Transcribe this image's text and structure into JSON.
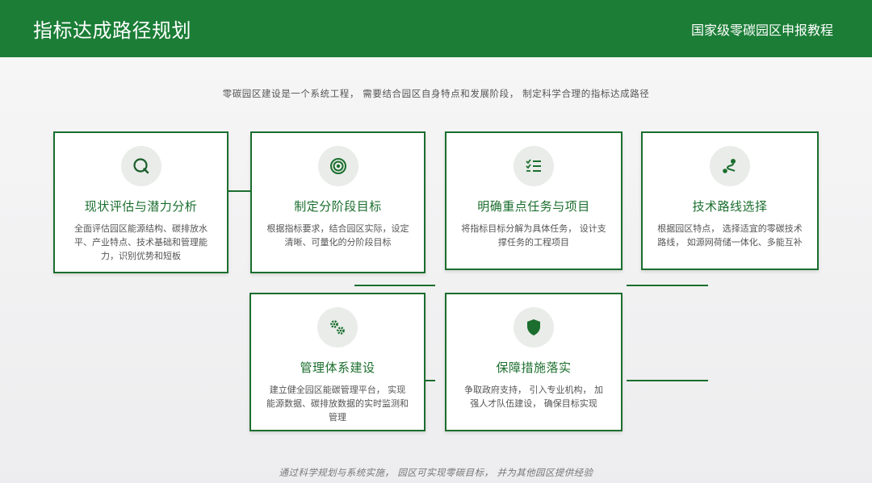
{
  "header": {
    "title": "指标达成路径规划",
    "subtitle": "国家级零碳园区申报教程"
  },
  "intro": "零碳园区建设是一个系统工程， 需要结合园区自身特点和发展阶段， 制定科学合理的指标达成路径",
  "cards": [
    {
      "icon": "search-icon",
      "title": "现状评估与潜力分析",
      "desc": "全面评估园区能源结构、碳排放水平、产业特点、技术基础和管理能力，识别优势和短板"
    },
    {
      "icon": "target-icon",
      "title": "制定分阶段目标",
      "desc": "根据指标要求，结合园区实际，设定清晰、可量化的分阶段目标"
    },
    {
      "icon": "task-list-icon",
      "title": "明确重点任务与项目",
      "desc": "将指标目标分解为具体任务， 设计支撑任务的工程项目"
    },
    {
      "icon": "route-icon",
      "title": "技术路线选择",
      "desc": "根据园区特点， 选择适宜的零碳技术路线， 如源网荷储一体化、多能互补"
    },
    {
      "icon": "gears-icon",
      "title": "管理体系建设",
      "desc": "建立健全园区能碳管理平台， 实现能源数据、碳排放数据的实时监测和管理"
    },
    {
      "icon": "shield-icon",
      "title": "保障措施落实",
      "desc": "争取政府支持， 引入专业机构， 加强人才队伍建设， 确保目标实现"
    }
  ],
  "footer": "通过科学规划与系统实施， 园区可实现零碳目标， 并为其他园区提供经验",
  "colors": {
    "primary": "#1b7d36",
    "card_border": "#1b6e2e",
    "icon_bg": "#e9ece9"
  }
}
